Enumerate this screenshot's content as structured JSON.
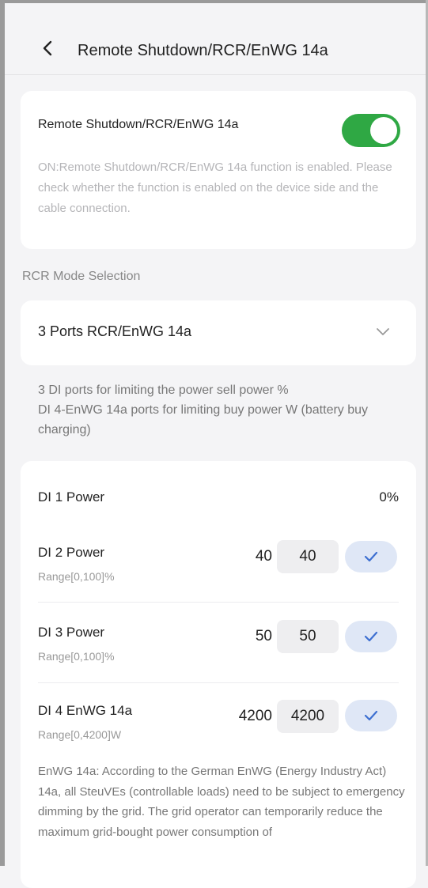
{
  "header": {
    "title": "Remote Shutdown/RCR/EnWG 14a",
    "back_icon": "chevron-left-icon"
  },
  "toggle_card": {
    "label": "Remote Shutdown/RCR/EnWG 14a",
    "state": "on",
    "accent": "#2fa844",
    "description": "ON:Remote Shutdown/RCR/EnWG 14a function is enabled. Please check whether the function is enabled on the device side and the cable connection."
  },
  "mode_section": {
    "label": "RCR Mode Selection",
    "selected": "3 Ports RCR/EnWG 14a",
    "dropdown_icon": "chevron-down-icon",
    "description_line1": "3 DI ports for limiting the power sell power %",
    "description_line2": "DI 4-EnWG 14a ports for limiting buy power W (battery buy charging)"
  },
  "power_card": {
    "di1": {
      "label": "DI 1 Power",
      "value": "0%"
    },
    "rows": [
      {
        "label": "DI 2 Power",
        "range": "Range[0,100]%",
        "current": "40",
        "input": "40"
      },
      {
        "label": "DI 3 Power",
        "range": "Range[0,100]%",
        "current": "50",
        "input": "50"
      },
      {
        "label": "DI 4 EnWG 14a",
        "range": "Range[0,4200]W",
        "current": "4200",
        "input": "4200"
      }
    ],
    "confirm_icon": "check-icon",
    "note": "EnWG 14a: According to the German EnWG (Energy Industry Act) 14a, all SteuVEs (controllable loads) need to be subject to emergency dimming by the grid. The grid operator can temporarily reduce the maximum grid-bought power consumption of"
  }
}
